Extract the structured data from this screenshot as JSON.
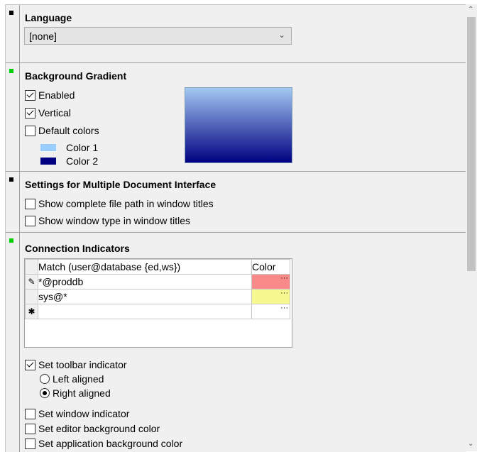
{
  "colors": {
    "marker_default": "#000000",
    "marker_modified": "#00d000",
    "gradient_top": "#a3c8f2",
    "gradient_bottom": "#000080",
    "color1_swatch": "#99ccff",
    "color2_swatch": "#000080",
    "prod_color": "#f88a8a",
    "sys_color": "#f8f890"
  },
  "language": {
    "title": "Language",
    "select_value": "[none]"
  },
  "gradient": {
    "title": "Background Gradient",
    "enabled_label": "Enabled",
    "enabled_checked": true,
    "vertical_label": "Vertical",
    "vertical_checked": true,
    "default_colors_label": "Default colors",
    "default_colors_checked": false,
    "color1_label": "Color 1",
    "color2_label": "Color 2"
  },
  "mdi": {
    "title": "Settings for Multiple Document Interface",
    "opt1_label": "Show complete file path in window titles",
    "opt2_label": "Show window type in window titles"
  },
  "connection": {
    "title": "Connection Indicators",
    "col_match": "Match (user@database {ed,ws})",
    "col_color": "Color",
    "rows": [
      {
        "match": "*@proddb"
      },
      {
        "match": "sys@*"
      }
    ],
    "ellipsis": "···",
    "set_toolbar_label": "Set toolbar indicator",
    "left_aligned_label": "Left aligned",
    "right_aligned_label": "Right aligned",
    "set_window_label": "Set window indicator",
    "set_editor_bg_label": "Set editor background color",
    "set_app_bg_label": "Set application background color"
  },
  "icons": {
    "edit_row": "pencil-icon",
    "new_row": "asterisk-icon",
    "scroll_up": "chevron-up-icon",
    "scroll_down": "chevron-down-icon"
  }
}
